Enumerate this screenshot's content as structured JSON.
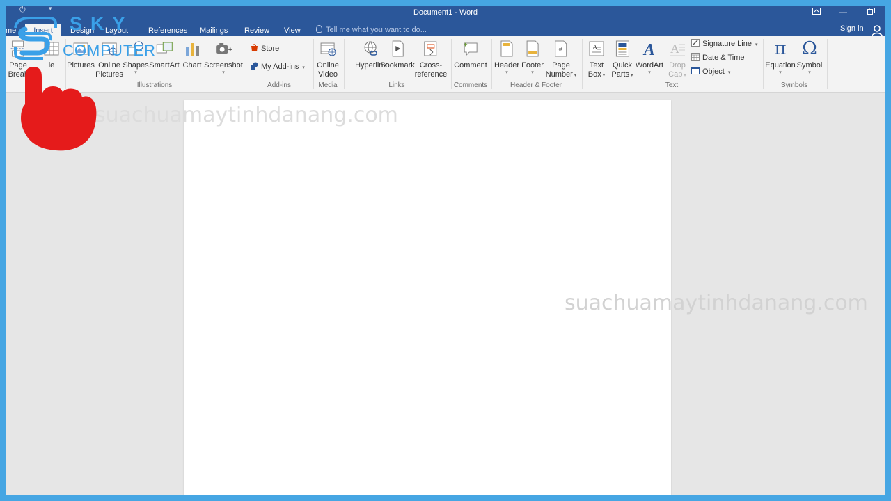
{
  "window": {
    "title": "Document1 - Word",
    "sign_in": "Sign in",
    "tell_me_placeholder": "Tell me what you want to do..."
  },
  "tabs": [
    "me",
    "Insert",
    "Design",
    "Layout",
    "References",
    "Mailings",
    "Review",
    "View"
  ],
  "ribbon": {
    "pages": {
      "page_break_l1": "Page",
      "page_break_l2": "Break"
    },
    "table": {
      "label": "le"
    },
    "illustrations": {
      "label": "Illustrations",
      "pictures": "Pictures",
      "online_pictures_l1": "Online",
      "online_pictures_l2": "Pictures",
      "shapes": "Shapes",
      "smartart": "SmartArt",
      "chart": "Chart",
      "screenshot": "Screenshot"
    },
    "addins": {
      "label": "Add-ins",
      "store": "Store",
      "my_addins": "My Add-ins"
    },
    "media": {
      "label": "Media",
      "online_video_l1": "Online",
      "online_video_l2": "Video"
    },
    "links": {
      "label": "Links",
      "hyperlink": "Hyperlink",
      "bookmark": "Bookmark",
      "cross_ref_l1": "Cross-",
      "cross_ref_l2": "reference"
    },
    "comments": {
      "label": "Comments",
      "comment": "Comment"
    },
    "header_footer": {
      "label": "Header & Footer",
      "header": "Header",
      "footer": "Footer",
      "page_number_l1": "Page",
      "page_number_l2": "Number"
    },
    "text": {
      "label": "Text",
      "text_box_l1": "Text",
      "text_box_l2": "Box",
      "quick_parts_l1": "Quick",
      "quick_parts_l2": "Parts",
      "wordart": "WordArt",
      "drop_cap_l1": "Drop",
      "drop_cap_l2": "Cap",
      "signature_line": "Signature Line",
      "date_time": "Date & Time",
      "object": "Object"
    },
    "symbols": {
      "label": "Symbols",
      "equation": "Equation",
      "symbol": "Symbol"
    }
  },
  "overlay": {
    "logo_top": "SKY",
    "logo_bottom": "COMPUTER",
    "watermark_1": "suachuamaytinhdanang.com",
    "watermark_2": "suachuamaytinhdanang.com"
  },
  "colors": {
    "title_bar": "#2b579a",
    "border": "#46a6e3",
    "pointer_hand": "#e51b1b",
    "logo": "#3aa0e8"
  }
}
